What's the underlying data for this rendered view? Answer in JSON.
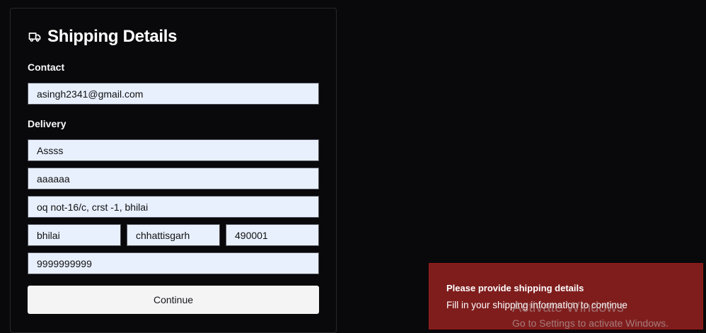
{
  "form": {
    "title": "Shipping Details",
    "icon": "truck-icon",
    "contact_label": "Contact",
    "delivery_label": "Delivery",
    "email": "asingh2341@gmail.com",
    "first_name": "Assss",
    "last_name": "aaaaaa",
    "address": "oq not-16/c, crst -1, bhilai",
    "city": "bhilai",
    "state": "chhattisgarh",
    "pincode": "490001",
    "phone": "9999999999",
    "continue_label": "Continue"
  },
  "toast": {
    "title": "Please provide shipping details",
    "description": "Fill in your shipping information to continue",
    "color": "#7f1d1d"
  },
  "watermark": {
    "title": "Activate Windows",
    "subtitle": "Go to Settings to activate Windows."
  }
}
